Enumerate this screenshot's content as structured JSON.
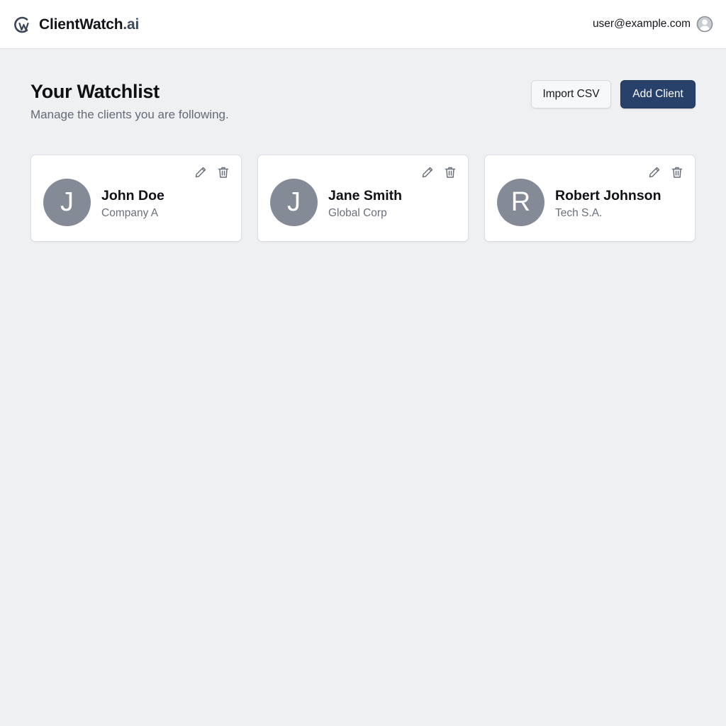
{
  "header": {
    "brand_main": "ClientWatch",
    "brand_tld": ".ai",
    "logo_icon": "cw-logo-icon",
    "user_email": "user@example.com",
    "user_icon": "user-avatar-icon"
  },
  "page": {
    "title": "Your Watchlist",
    "subtitle": "Manage the clients you are following.",
    "import_label": "Import CSV",
    "add_label": "Add Client"
  },
  "clients": [
    {
      "initial": "J",
      "name": "John Doe",
      "company": "Company A"
    },
    {
      "initial": "J",
      "name": "Jane Smith",
      "company": "Global Corp"
    },
    {
      "initial": "R",
      "name": "Robert Johnson",
      "company": "Tech S.A."
    }
  ],
  "card_actions": {
    "edit_icon": "pencil-icon",
    "delete_icon": "trash-icon"
  },
  "colors": {
    "background": "#eff0f2",
    "primary": "#27416a",
    "avatar": "#858b96",
    "muted_text": "#646b76"
  }
}
